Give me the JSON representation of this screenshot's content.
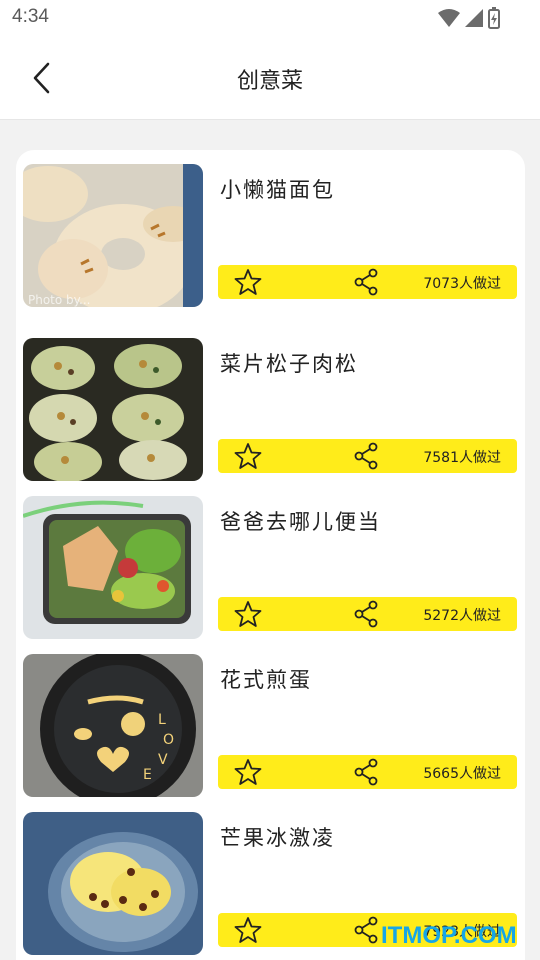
{
  "status": {
    "time": "4:34"
  },
  "header": {
    "title": "创意菜"
  },
  "recipes": [
    {
      "title": "小懒猫面包",
      "made": "7073人做过"
    },
    {
      "title": "菜片松子肉松",
      "made": "7581人做过"
    },
    {
      "title": "爸爸去哪儿便当",
      "made": "5272人做过"
    },
    {
      "title": "花式煎蛋",
      "made": "5665人做过"
    },
    {
      "title": "芒果冰激凌",
      "made": "7923人做过"
    }
  ],
  "watermark": "ITMOP.COM",
  "colors": {
    "accent": "#ffec1a",
    "card": "#ffffff",
    "background": "#f2f2f2"
  }
}
